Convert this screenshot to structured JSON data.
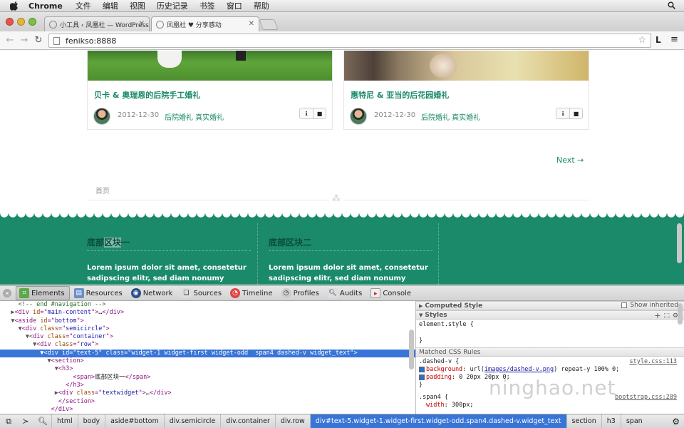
{
  "menubar": {
    "app": "Chrome",
    "items": [
      "文件",
      "编辑",
      "视图",
      "历史记录",
      "书签",
      "窗口",
      "帮助"
    ]
  },
  "tabs": [
    {
      "label": "小工具 ‹ 凤凰社 — WordPress",
      "active": false
    },
    {
      "label": "凤凰社 ♥ 分享感动",
      "active": true
    }
  ],
  "toolbar": {
    "url": "feniksо:8888",
    "right_button": "L"
  },
  "page": {
    "cards": [
      {
        "title": "贝卡 & 奥瑞恩的后院手工婚礼",
        "date": "2012-12-30",
        "tags": "后院婚礼 真实婚礼"
      },
      {
        "title": "惠特尼 & 亚当的后花园婚礼",
        "date": "2012-12-30",
        "tags": "后院婚礼 真实婚礼"
      }
    ],
    "next_link": "Next →",
    "breadcrumb": "首页",
    "footer_widgets": [
      {
        "heading_pre": "底部",
        "heading_hl": "区块",
        "heading_post": "一",
        "text": "Lorem ipsum dolor sit amet, consetetur sadipscing elitr, sed diam nonumy eirmod"
      },
      {
        "heading_pre": "底部区块二",
        "heading_hl": "",
        "heading_post": "",
        "text": "Lorem ipsum dolor sit amet, consetetur sadipscing elitr, sed diam nonumy eirmod"
      }
    ]
  },
  "devtools": {
    "panels": [
      "Elements",
      "Resources",
      "Network",
      "Sources",
      "Timeline",
      "Profiles",
      "Audits",
      "Console"
    ],
    "active_panel": "Elements",
    "dom_lines": [
      {
        "indent": "    ",
        "arrow": "",
        "html": "<span class=\"cm\">&lt;!-- end #navigation --&gt;</span>"
      },
      {
        "indent": "   ",
        "arrow": "▶",
        "html": "&lt;div <span class=\"attr\">id</span>=\"<span class=\"val\">main-content</span>\"&gt;<span class=\"tx\">…</span>&lt;/div&gt;"
      },
      {
        "indent": "   ",
        "arrow": "▼",
        "html": "&lt;aside <span class=\"attr\">id</span>=\"<span class=\"val\">bottom</span>\"&gt;"
      },
      {
        "indent": "     ",
        "arrow": "▼",
        "html": "&lt;div <span class=\"attr\">class</span>=\"<span class=\"val\">semicircle</span>\"&gt;"
      },
      {
        "indent": "       ",
        "arrow": "▼",
        "html": "&lt;div <span class=\"attr\">class</span>=\"<span class=\"val\">container</span>\"&gt;"
      },
      {
        "indent": "         ",
        "arrow": "▼",
        "html": "&lt;div <span class=\"attr\">class</span>=\"<span class=\"val\">row</span>\"&gt;"
      },
      {
        "indent": "           ",
        "arrow": "▼",
        "html": "&lt;div <span class=\"attr\">id</span>=\"<span class=\"val\">text-5</span>\" <span class=\"attr\">class</span>=\"<span class=\"val\">widget-1 widget-first widget-odd  span4 dashed-v widget_text</span>\"&gt;",
        "selected": true
      },
      {
        "indent": "             ",
        "arrow": "▼",
        "html": "&lt;section&gt;"
      },
      {
        "indent": "               ",
        "arrow": "▼",
        "html": "&lt;h3&gt;"
      },
      {
        "indent": "                   ",
        "arrow": "",
        "html": "&lt;span&gt;<span class=\"tx\">底部区块一</span>&lt;/span&gt;"
      },
      {
        "indent": "                 ",
        "arrow": "",
        "html": "&lt;/h3&gt;"
      },
      {
        "indent": "               ",
        "arrow": "▶",
        "html": "&lt;div <span class=\"attr\">class</span>=\"<span class=\"val\">textwidget</span>\"&gt;<span class=\"tx\">…</span>&lt;/div&gt;"
      },
      {
        "indent": "               ",
        "arrow": "",
        "html": "&lt;/section&gt;"
      },
      {
        "indent": "             ",
        "arrow": "",
        "html": "&lt;/div&gt;"
      }
    ],
    "styles": {
      "computed_title": "Computed Style",
      "show_inherited": "Show inherited",
      "styles_title": "Styles",
      "element_style": "element.style {",
      "close_brace": "}",
      "matched_title": "Matched CSS Rules",
      "rule1_selector": ".dashed-v {",
      "rule1_source": "style.css:113",
      "rule1_prop1": "background",
      "rule1_val1_pre": "url(",
      "rule1_val1_link": "images/dashed-v.png",
      "rule1_val1_post": ") repeat-y 100% 0;",
      "rule1_prop2": "padding",
      "rule1_val2": "0 20px 20px 0;",
      "rule2_selector": ".span4 {",
      "rule2_source": "bootstrap.css:289",
      "rule2_prop1": "width",
      "rule2_val1": "300px;"
    },
    "breadcrumbs": [
      "html",
      "body",
      "aside#bottom",
      "div.semicircle",
      "div.container",
      "div.row",
      "div#text-5.widget-1.widget-first.widget-odd.span4.dashed-v.widget_text",
      "section",
      "h3",
      "span"
    ],
    "selected_crumb": 6
  },
  "watermark": "ninghao.net",
  "colors": {
    "accent": "#1a8a6a",
    "selection": "#3875d7"
  }
}
